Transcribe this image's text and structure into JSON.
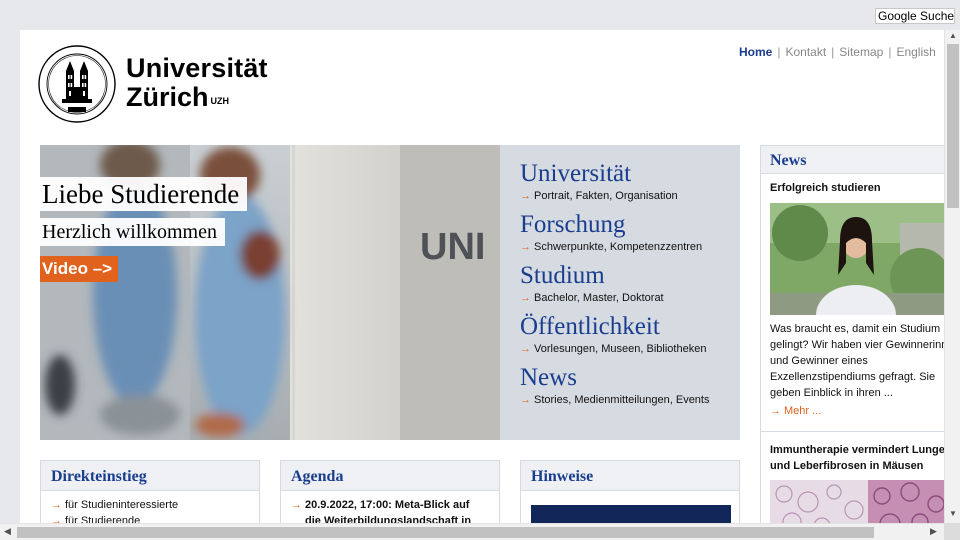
{
  "search": {
    "label": "Google Suche"
  },
  "logo": {
    "line1": "Universität",
    "line2": "Zürich",
    "badge": "UZH"
  },
  "topnav": [
    {
      "label": "Home",
      "active": true
    },
    {
      "label": "Kontakt",
      "active": false
    },
    {
      "label": "Sitemap",
      "active": false
    },
    {
      "label": "English",
      "active": false
    }
  ],
  "hero": {
    "title": "Liebe Studierende",
    "subtitle": "Herzlich willkommen",
    "video_label": "Video –>",
    "wall_text": "UNI"
  },
  "categories": [
    {
      "title": "Universität",
      "sub": "Portrait, Fakten, Organisation"
    },
    {
      "title": "Forschung",
      "sub": "Schwerpunkte, Kompetenzzentren"
    },
    {
      "title": "Studium",
      "sub": "Bachelor, Master, Doktorat"
    },
    {
      "title": "Öffentlichkeit",
      "sub": "Vorlesungen, Museen, Bibliotheken"
    },
    {
      "title": "News",
      "sub": "Stories, Medienmitteilungen, Events"
    }
  ],
  "news": {
    "heading": "News",
    "item1": {
      "title": "Erfolgreich studieren",
      "lines": [
        "Was braucht es, damit ein Studium",
        "gelingt? Wir haben vier Gewinnerinnen",
        "und Gewinner eines",
        "Exzellenzstipendiums gefragt. Sie",
        "geben Einblick in ihren ..."
      ],
      "more": "Mehr ..."
    },
    "item2": {
      "title_lines": [
        "Immuntherapie vermindert Lungen-",
        "und Leberfibrosen in Mäusen"
      ]
    }
  },
  "boxes": {
    "direkteinstieg": {
      "heading": "Direkteinstieg",
      "items": [
        "für Studieninteressierte",
        "für Studierende"
      ]
    },
    "agenda": {
      "heading": "Agenda",
      "lines": [
        "20.9.2022, 17:00: Meta-Blick auf",
        "die Weiterbildungslandschaft in"
      ]
    },
    "hinweise": {
      "heading": "Hinweise"
    }
  },
  "colors": {
    "brand_blue": "#1a3d8f",
    "accent_orange": "#e0621d",
    "menu_bg": "#d6dbe1"
  }
}
